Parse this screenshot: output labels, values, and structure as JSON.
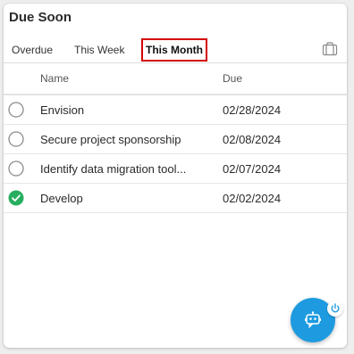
{
  "widget": {
    "title": "Due Soon"
  },
  "tabs": [
    {
      "label": "Overdue",
      "selected": false
    },
    {
      "label": "This Week",
      "selected": false
    },
    {
      "label": "This Month",
      "selected": true
    }
  ],
  "toolbar": {
    "icon": "briefcase-icon"
  },
  "table": {
    "columns": [
      "Name",
      "Due"
    ],
    "rows": [
      {
        "name": "Envision",
        "due": "02/28/2024",
        "completed": false
      },
      {
        "name": "Secure project sponsorship",
        "due": "02/08/2024",
        "completed": false
      },
      {
        "name": "Identify data migration tool...",
        "due": "02/07/2024",
        "completed": false
      },
      {
        "name": "Develop",
        "due": "02/02/2024",
        "completed": true
      }
    ]
  },
  "assistant": {
    "icon": "bot-icon",
    "badge_icon": "power-icon"
  },
  "colors": {
    "accent": "#1e9be0",
    "complete": "#27ae60",
    "highlight_border": "#d40000"
  }
}
